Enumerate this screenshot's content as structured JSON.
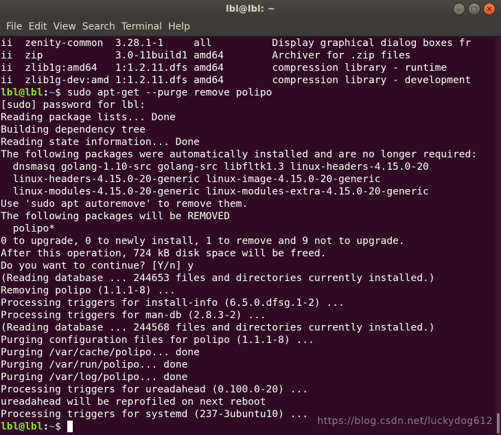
{
  "window": {
    "title": "lbl@lbl: ~"
  },
  "menu": [
    "File",
    "Edit",
    "View",
    "Search",
    "Terminal",
    "Help"
  ],
  "terminal": {
    "prompt": {
      "user": "lbl@lbl",
      "path": "~",
      "symbol": "$ "
    },
    "lines": [
      {
        "type": "text",
        "text": "ii  zenity-common  3.28.1-1     all          Display graphical dialog boxes fr"
      },
      {
        "type": "text",
        "text": "ii  zip            3.0-11build1 amd64        Archiver for .zip files"
      },
      {
        "type": "text",
        "text": "ii  zlib1g:amd64   1:1.2.11.dfs amd64        compression library - runtime"
      },
      {
        "type": "text",
        "text": "ii  zlib1g-dev:amd 1:1.2.11.dfs amd64        compression library - development"
      },
      {
        "type": "prompt",
        "text": "sudo apt-get --purge remove polipo"
      },
      {
        "type": "text",
        "text": "[sudo] password for lbl:"
      },
      {
        "type": "text",
        "text": "Reading package lists... Done"
      },
      {
        "type": "text",
        "text": "Building dependency tree"
      },
      {
        "type": "text",
        "text": "Reading state information... Done"
      },
      {
        "type": "text",
        "text": "The following packages were automatically installed and are no longer required:"
      },
      {
        "type": "text",
        "text": "  dnsmasq golang-1.10-src golang-src libfltk1.3 linux-headers-4.15.0-20"
      },
      {
        "type": "text",
        "text": "  linux-headers-4.15.0-20-generic linux-image-4.15.0-20-generic"
      },
      {
        "type": "text",
        "text": "  linux-modules-4.15.0-20-generic linux-modules-extra-4.15.0-20-generic"
      },
      {
        "type": "text",
        "text": "Use 'sudo apt autoremove' to remove them."
      },
      {
        "type": "text",
        "text": "The following packages will be REMOVED"
      },
      {
        "type": "text",
        "text": "  polipo*"
      },
      {
        "type": "text",
        "text": "0 to upgrade, 0 to newly install, 1 to remove and 9 not to upgrade."
      },
      {
        "type": "text",
        "text": "After this operation, 724 kB disk space will be freed."
      },
      {
        "type": "text",
        "text": "Do you want to continue? [Y/n] y"
      },
      {
        "type": "text",
        "text": "(Reading database ... 244653 files and directories currently installed.)"
      },
      {
        "type": "text",
        "text": "Removing polipo (1.1.1-8) ..."
      },
      {
        "type": "text",
        "text": "Processing triggers for install-info (6.5.0.dfsg.1-2) ..."
      },
      {
        "type": "text",
        "text": "Processing triggers for man-db (2.8.3-2) ..."
      },
      {
        "type": "text",
        "text": "(Reading database ... 244568 files and directories currently installed.)"
      },
      {
        "type": "text",
        "text": "Purging configuration files for polipo (1.1.1-8) ..."
      },
      {
        "type": "text",
        "text": "Purging /var/cache/polipo... done"
      },
      {
        "type": "text",
        "text": "Purging /var/run/polipo... done"
      },
      {
        "type": "text",
        "text": "Purging /var/log/polipo... done"
      },
      {
        "type": "text",
        "text": "Processing triggers for ureadahead (0.100.0-20) ..."
      },
      {
        "type": "text",
        "text": "ureadahead will be reprofiled on next reboot"
      },
      {
        "type": "text",
        "text": "Processing triggers for systemd (237-3ubuntu10) ..."
      },
      {
        "type": "prompt",
        "text": "",
        "cursor": true
      }
    ]
  },
  "watermark": "https://blog.csdn.net/luckydog612",
  "colors": {
    "background": "#300a24",
    "titlebar": "#3c3b37",
    "text": "#ffffff",
    "prompt_user": "#8ae234",
    "prompt_path": "#729fcf",
    "close_button": "#e0561d"
  },
  "icons": {
    "minimize": "minimize-icon",
    "maximize": "maximize-icon",
    "close": "close-icon"
  }
}
